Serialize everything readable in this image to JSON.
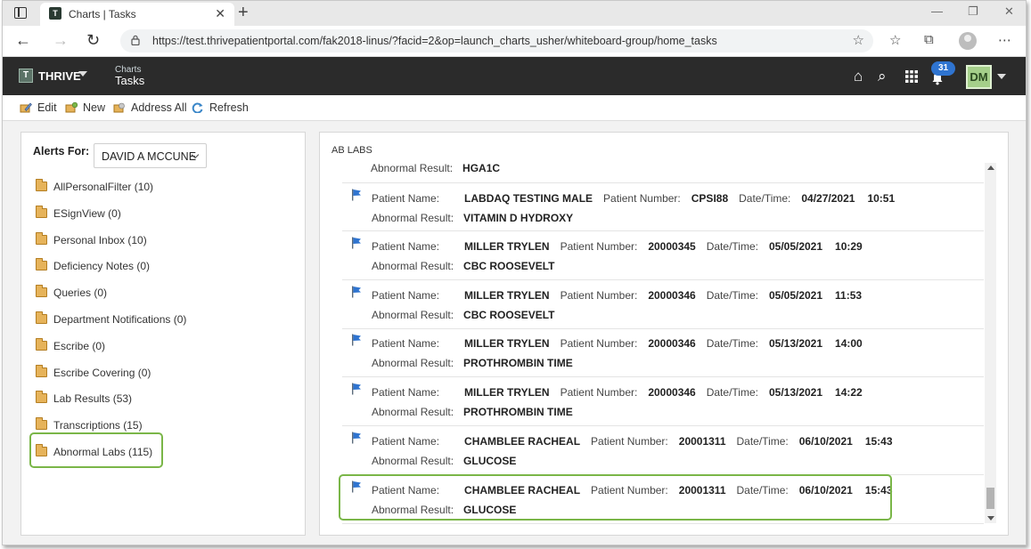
{
  "browser": {
    "tab_title": "Charts | Tasks",
    "tab_favicon": "T",
    "url": "https://test.thrivepatientportal.com/fak2018-linus/?facid=2&op=launch_charts_usher/whiteboard-group/home_tasks"
  },
  "header": {
    "brand_box": "T",
    "brand": "THRIVE",
    "crumb_top": "Charts",
    "crumb_main": "Tasks",
    "notification_count": "31",
    "user_initials": "DM"
  },
  "toolbar": {
    "edit": "Edit",
    "new": "New",
    "address_all": "Address All",
    "refresh": "Refresh"
  },
  "alerts": {
    "label": "Alerts For:",
    "selected_user": "DAVID A MCCUNE",
    "folders": [
      "AllPersonalFilter (10)",
      "ESignView (0)",
      "Personal Inbox (10)",
      "Deficiency Notes (0)",
      "Queries (0)",
      "Department Notifications (0)",
      "Escribe (0)",
      "Escribe Covering (0)",
      "Lab Results (53)",
      "Transcriptions (15)",
      "Abnormal Labs (115)"
    ]
  },
  "labels": {
    "patient_name": "Patient Name:",
    "patient_number": "Patient Number:",
    "date_time": "Date/Time:",
    "abnormal_result": "Abnormal Result:"
  },
  "list": {
    "title": "AB LABS",
    "partial_result": "HGA1C",
    "records": [
      {
        "name": "LABDAQ TESTING MALE",
        "number": "CPSI88",
        "date": "04/27/2021",
        "time": "10:51",
        "result": "VITAMIN D HYDROXY"
      },
      {
        "name": "MILLER TRYLEN",
        "number": "20000345",
        "date": "05/05/2021",
        "time": "10:29",
        "result": "CBC ROOSEVELT"
      },
      {
        "name": "MILLER TRYLEN",
        "number": "20000346",
        "date": "05/05/2021",
        "time": "11:53",
        "result": "CBC ROOSEVELT"
      },
      {
        "name": "MILLER TRYLEN",
        "number": "20000346",
        "date": "05/13/2021",
        "time": "14:00",
        "result": "PROTHROMBIN TIME"
      },
      {
        "name": "MILLER TRYLEN",
        "number": "20000346",
        "date": "05/13/2021",
        "time": "14:22",
        "result": "PROTHROMBIN TIME"
      },
      {
        "name": "CHAMBLEE RACHEAL",
        "number": "20001311",
        "date": "06/10/2021",
        "time": "15:43",
        "result": "GLUCOSE"
      },
      {
        "name": "CHAMBLEE RACHEAL",
        "number": "20001311",
        "date": "06/10/2021",
        "time": "15:43",
        "result": "GLUCOSE"
      }
    ]
  },
  "colors": {
    "highlight": "#7ab648",
    "appbar": "#2b2b2b",
    "flag": "#2f74d0",
    "folder": "#e6b35a"
  }
}
